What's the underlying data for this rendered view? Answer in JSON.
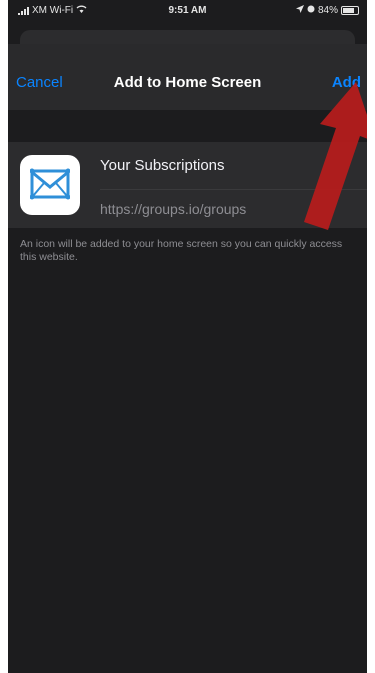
{
  "status_bar": {
    "carrier": "XM Wi-Fi",
    "time": "9:51 AM",
    "battery": "84%"
  },
  "nav": {
    "cancel_label": "Cancel",
    "title": "Add to Home Screen",
    "add_label": "Add"
  },
  "shortcut": {
    "name": "Your Subscriptions",
    "url": "https://groups.io/groups"
  },
  "note": "An icon will be added to your home screen so you can quickly access this website.",
  "colors": {
    "accent": "#0a84ff",
    "background": "#1c1c1e",
    "annotation_arrow": "#b91c1c"
  },
  "icons": {
    "app_icon": "envelope-icon",
    "annotation": "red-arrow-icon"
  }
}
